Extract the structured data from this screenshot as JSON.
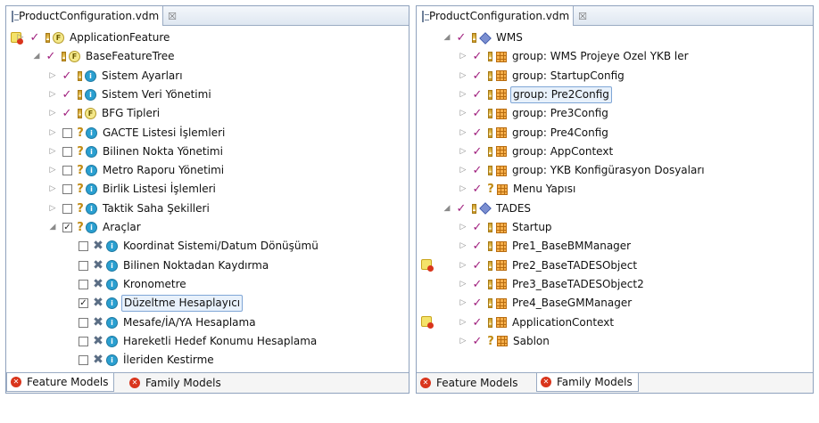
{
  "colors": {
    "check": "#a0207e",
    "selection": "#e8f1fb",
    "border": "#8fa2bd",
    "error": "#d9351c"
  },
  "left": {
    "tab_title": "ProductConfiguration.vdm",
    "tab_close": "☒",
    "rows": [
      {
        "warn": true,
        "toggle": "▷",
        "check": "check",
        "mark": "bang",
        "icon": "F",
        "label": "ApplicationFeature"
      },
      {
        "toggle": "◢",
        "check": "check",
        "mark": "bang",
        "icon": "F",
        "label": "BaseFeatureTree"
      },
      {
        "toggle": "▷",
        "check": "check",
        "mark": "bang",
        "icon": "i",
        "label": "Sistem Ayarları"
      },
      {
        "toggle": "▷",
        "check": "check",
        "mark": "bang",
        "icon": "i",
        "label": "Sistem Veri Yönetimi"
      },
      {
        "toggle": "▷",
        "check": "check",
        "mark": "bang",
        "icon": "F",
        "label": "BFG Tipleri"
      },
      {
        "toggle": "▷",
        "check": "box",
        "mark": "q",
        "icon": "i",
        "label": "GACTE Listesi İşlemleri"
      },
      {
        "toggle": "▷",
        "check": "box",
        "mark": "q",
        "icon": "i",
        "label": "Bilinen Nokta Yönetimi"
      },
      {
        "toggle": "▷",
        "check": "box",
        "mark": "q",
        "icon": "i",
        "label": "Metro Raporu Yönetimi"
      },
      {
        "toggle": "▷",
        "check": "box",
        "mark": "q",
        "icon": "i",
        "label": "Birlik Listesi İşlemleri"
      },
      {
        "toggle": "▷",
        "check": "box",
        "mark": "q",
        "icon": "i",
        "label": "Taktik Saha Şekilleri"
      },
      {
        "toggle": "◢",
        "check": "boxchecked",
        "mark": "q",
        "icon": "i",
        "label": "Araçlar"
      },
      {
        "toggle": "",
        "check": "box",
        "mark": "x",
        "icon": "i",
        "label": "Koordinat Sistemi/Datum Dönüşümü"
      },
      {
        "toggle": "",
        "check": "box",
        "mark": "x",
        "icon": "i",
        "label": "Bilinen Noktadan Kaydırma"
      },
      {
        "toggle": "",
        "check": "box",
        "mark": "x",
        "icon": "i",
        "label": "Kronometre"
      },
      {
        "toggle": "",
        "check": "boxchecked",
        "mark": "x",
        "icon": "i",
        "label": "Düzeltme Hesaplayıcı",
        "selected": true
      },
      {
        "toggle": "",
        "check": "box",
        "mark": "x",
        "icon": "i",
        "label": "Mesafe/İA/YA Hesaplama"
      },
      {
        "toggle": "",
        "check": "box",
        "mark": "x",
        "icon": "i",
        "label": "Hareketli Hedef Konumu Hesaplama"
      },
      {
        "toggle": "",
        "check": "box",
        "mark": "x",
        "icon": "i",
        "label": "İleriden Kestirme"
      }
    ],
    "bottom_tabs": [
      {
        "label": "Feature Models",
        "active": true
      },
      {
        "label": "Family Models",
        "active": false
      }
    ]
  },
  "right": {
    "tab_title": "ProductConfiguration.vdm",
    "tab_close": "☒",
    "rows": [
      {
        "toggle": "◢",
        "check": "check",
        "mark": "bang",
        "icon": "cube",
        "label": "WMS"
      },
      {
        "toggle": "▷",
        "check": "check",
        "mark": "bang",
        "icon": "grid",
        "label": "group: WMS Projeye Ozel YKB ler"
      },
      {
        "toggle": "▷",
        "check": "check",
        "mark": "bang",
        "icon": "grid",
        "label": "group: StartupConfig"
      },
      {
        "toggle": "▷",
        "check": "check",
        "mark": "bang",
        "icon": "grid",
        "label": "group: Pre2Config",
        "selected": true
      },
      {
        "toggle": "▷",
        "check": "check",
        "mark": "bang",
        "icon": "grid",
        "label": "group: Pre3Config"
      },
      {
        "toggle": "▷",
        "check": "check",
        "mark": "bang",
        "icon": "grid",
        "label": "group: Pre4Config"
      },
      {
        "toggle": "▷",
        "check": "check",
        "mark": "bang",
        "icon": "grid",
        "label": "group: AppContext"
      },
      {
        "toggle": "▷",
        "check": "check",
        "mark": "bang",
        "icon": "grid",
        "label": "group: YKB Konfigürasyon Dosyaları"
      },
      {
        "toggle": "▷",
        "check": "check",
        "mark": "q",
        "icon": "grid",
        "label": "Menu Yapısı"
      },
      {
        "toggle": "◢",
        "check": "check",
        "mark": "bang",
        "icon": "cube",
        "label": "TADES"
      },
      {
        "toggle": "▷",
        "check": "check",
        "mark": "bang",
        "icon": "grid",
        "label": "Startup"
      },
      {
        "toggle": "▷",
        "check": "check",
        "mark": "bang",
        "icon": "grid",
        "label": "Pre1_BaseBMManager"
      },
      {
        "warn": true,
        "toggle": "▷",
        "check": "check",
        "mark": "bang",
        "icon": "grid",
        "label": "Pre2_BaseTADESObject"
      },
      {
        "toggle": "▷",
        "check": "check",
        "mark": "bang",
        "icon": "grid",
        "label": "Pre3_BaseTADESObject2"
      },
      {
        "toggle": "▷",
        "check": "check",
        "mark": "bang",
        "icon": "grid",
        "label": "Pre4_BaseGMManager"
      },
      {
        "warn": true,
        "toggle": "▷",
        "check": "check",
        "mark": "bang",
        "icon": "grid",
        "label": "ApplicationContext"
      },
      {
        "toggle": "▷",
        "check": "check",
        "mark": "q",
        "icon": "grid",
        "label": "Sablon"
      }
    ],
    "bottom_tabs": [
      {
        "label": "Feature Models",
        "active": false
      },
      {
        "label": "Family Models",
        "active": true
      }
    ]
  }
}
